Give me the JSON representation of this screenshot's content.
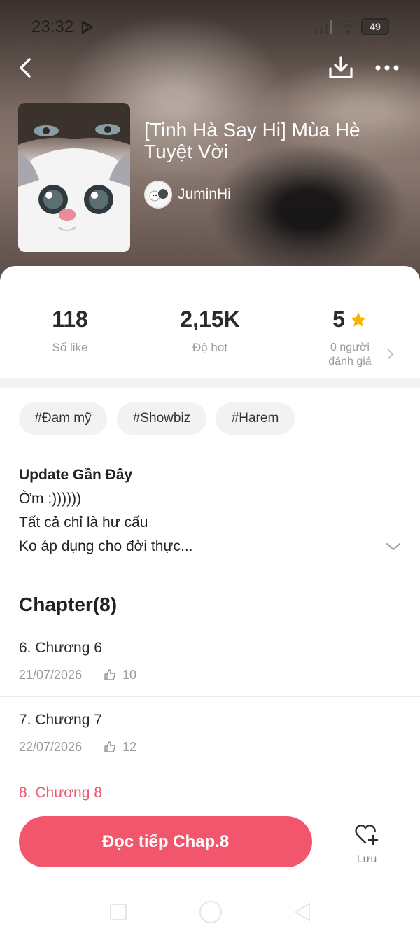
{
  "status_bar": {
    "time": "23:32",
    "battery": "49"
  },
  "header": {
    "icons": [
      "back-icon",
      "download-icon",
      "more-icon"
    ]
  },
  "book": {
    "title": "[Tinh Hà Say Hi] Mùa Hè Tuyệt Vời",
    "author": "JuminHi"
  },
  "stats": {
    "likes_value": "118",
    "likes_label": "Số like",
    "hot_value": "2,15K",
    "hot_label": "Độ hot",
    "rating_value": "5",
    "rating_label_1": "0 người",
    "rating_label_2": "đánh giá"
  },
  "tags": [
    "#Đam mỹ",
    "#Showbiz",
    "#Harem"
  ],
  "update": {
    "title": "Update Gần Đây",
    "line1": "Ờm :))))))",
    "line2": "Tất cả chỉ là hư cấu",
    "line3": "Ko áp dụng cho đời thực..."
  },
  "chapters": {
    "heading": "Chapter(8)",
    "items": [
      {
        "title": "6. Chương 6",
        "date": "21/07/2026",
        "likes": "10"
      },
      {
        "title": "7. Chương 7",
        "date": "22/07/2026",
        "likes": "12"
      },
      {
        "title": "8. Chương 8"
      }
    ]
  },
  "bottom_bar": {
    "read_button": "Đọc tiếp Chap.8",
    "save_label": "Lưu"
  },
  "colors": {
    "accent": "#f2566d",
    "star": "#f7b500"
  }
}
